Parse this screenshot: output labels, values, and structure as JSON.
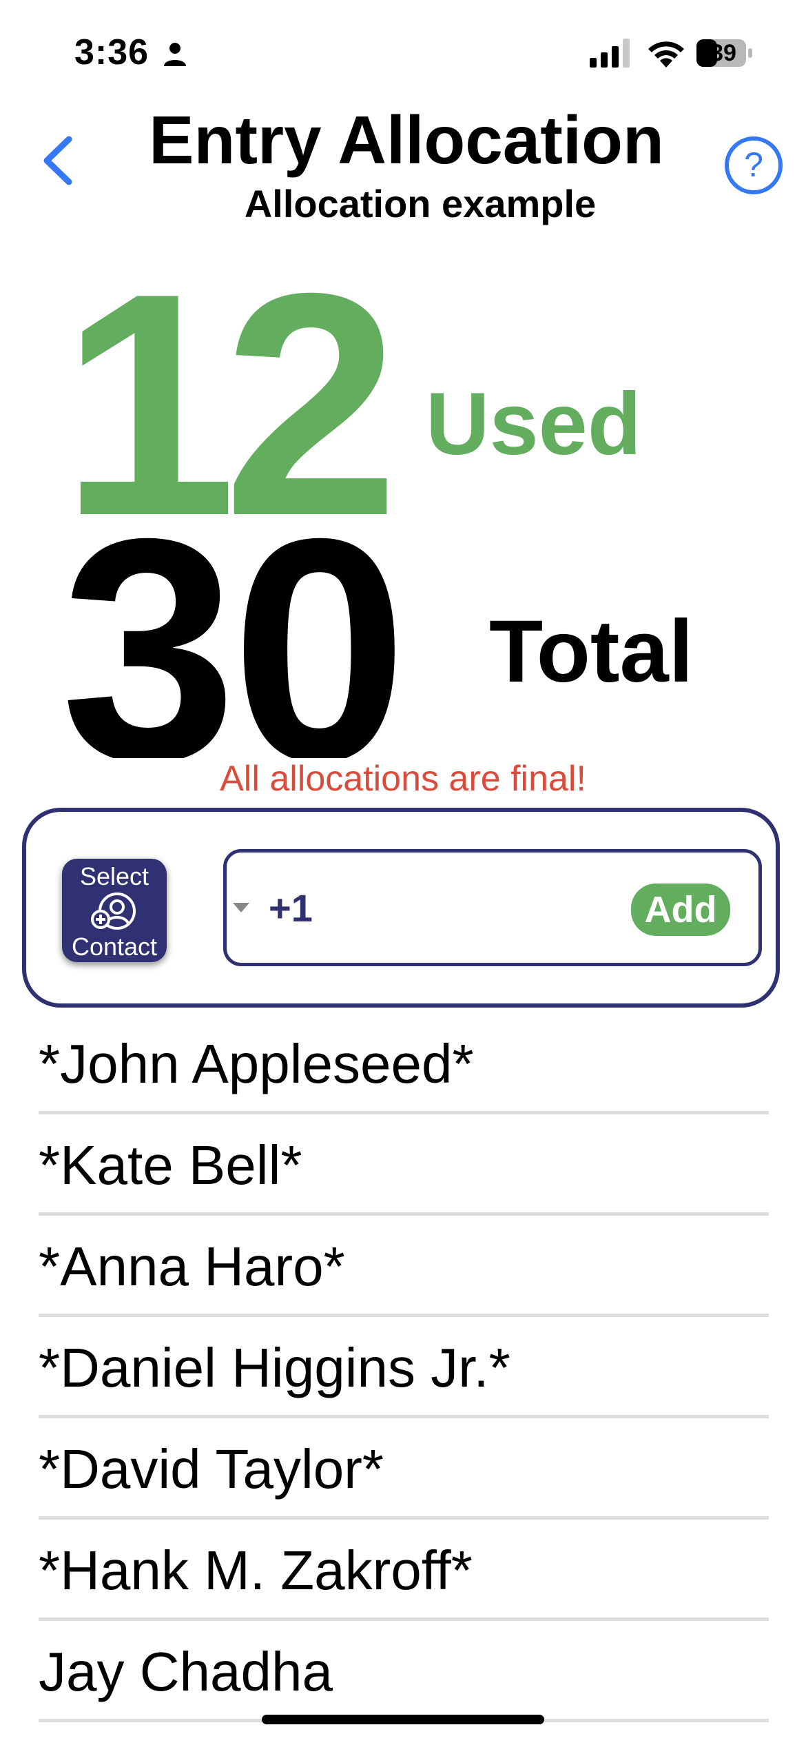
{
  "status_bar": {
    "time": "3:36",
    "battery": "39",
    "person_icon": "person-icon",
    "signal_icon": "cellular-signal-icon",
    "wifi_icon": "wifi-icon",
    "battery_icon": "battery-icon"
  },
  "header": {
    "title": "Entry Allocation",
    "subtitle": "Allocation example",
    "back_icon": "chevron-left-icon",
    "help_icon": "question-circle-icon"
  },
  "counters": {
    "used_value": "12",
    "used_label": "Used",
    "total_value": "30",
    "total_label": "Total"
  },
  "warning": "All allocations are final!",
  "entry": {
    "select_contact_line1": "Select",
    "select_contact_line2": "Contact",
    "contact_icon": "add-contact-icon",
    "country_code": "+1",
    "caret_icon": "caret-down-icon",
    "add_label": "Add"
  },
  "contacts": [
    "*John Appleseed*",
    "*Kate Bell*",
    "*Anna Haro*",
    "*Daniel Higgins Jr.*",
    "*David Taylor*",
    "*Hank M. Zakroff*",
    "Jay Chadha"
  ],
  "colors": {
    "accent_green": "#63ad5f",
    "navy": "#2f3173",
    "warning_red": "#d94b3b",
    "link_blue": "#3478f6"
  }
}
